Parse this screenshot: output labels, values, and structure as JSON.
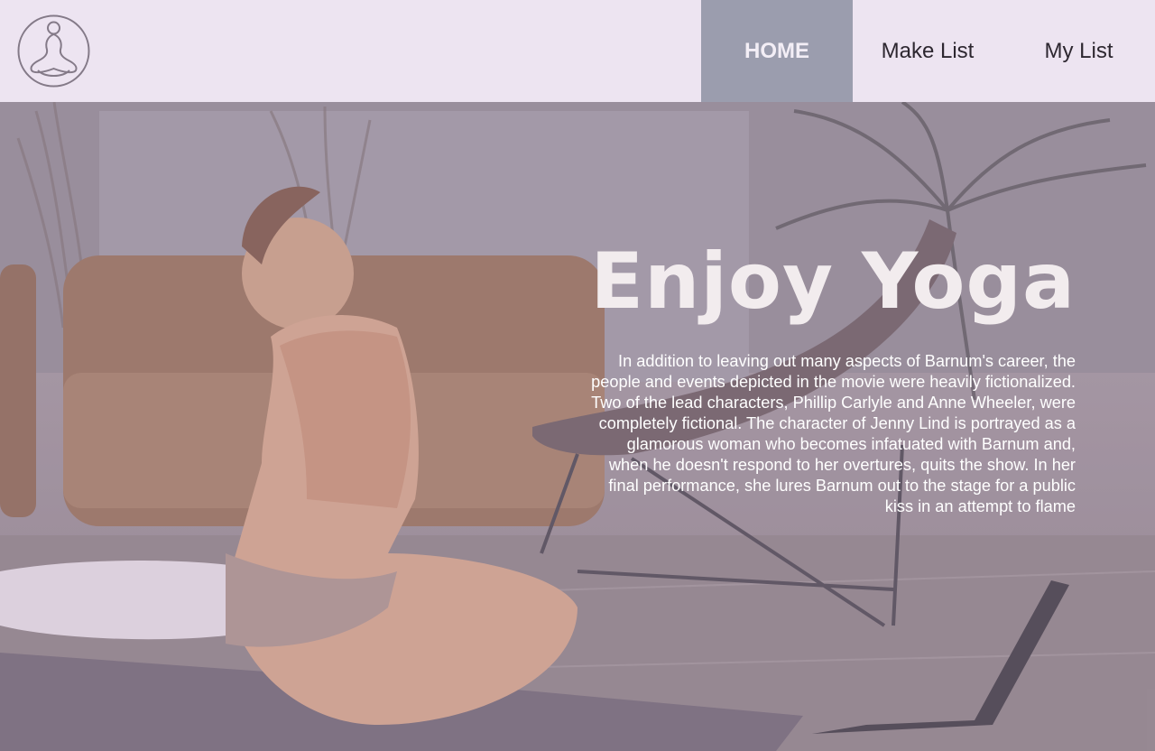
{
  "header": {
    "logo_icon": "meditation-logo-icon",
    "nav": [
      {
        "label": "HOME",
        "active": true
      },
      {
        "label": "Make List",
        "active": false
      },
      {
        "label": "My List",
        "active": false
      }
    ]
  },
  "hero": {
    "title": "Enjoy Yoga",
    "body": "In addition to leaving out many aspects of Barnum's career, the people and events depicted in the movie were heavily fictionalized. Two of the lead characters, Phillip Carlyle and Anne Wheeler, were completely fictional. The character of Jenny Lind is portrayed as a glamorous woman who becomes infatuated with Barnum and, when he doesn't respond to her overtures, quits the show. In her final performance, she lures Barnum out to the stage for a public kiss in an attempt to flame"
  },
  "colors": {
    "header_bg": "#ede4f1",
    "nav_active_bg": "#9b9dae",
    "nav_text": "#2d2730",
    "hero_title": "#f2ecee"
  }
}
